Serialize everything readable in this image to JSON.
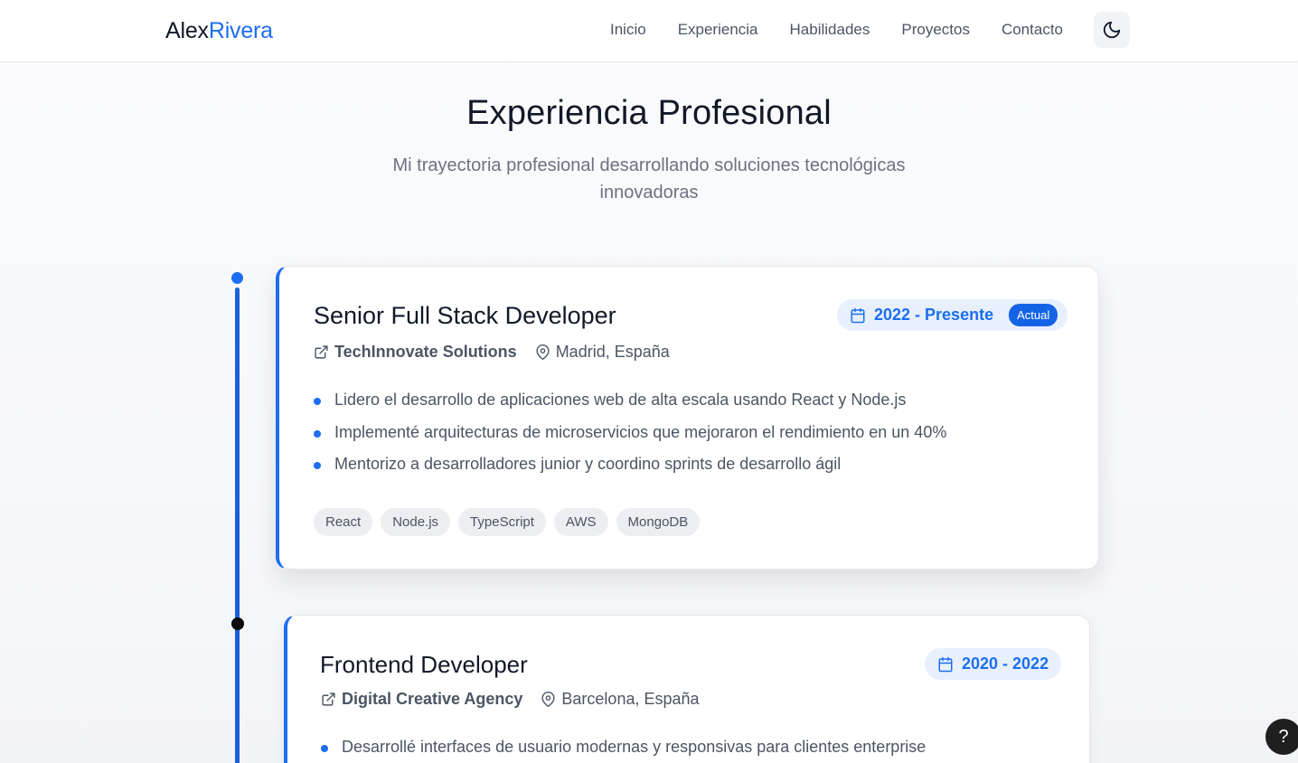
{
  "header": {
    "logo_first": "Alex",
    "logo_last": "Rivera",
    "nav": [
      "Inicio",
      "Experiencia",
      "Habilidades",
      "Proyectos",
      "Contacto"
    ],
    "theme_icon": "moon-icon"
  },
  "section": {
    "title": "Experiencia Profesional",
    "subtitle": "Mi trayectoria profesional desarrollando soluciones tecnológicas innovadoras"
  },
  "jobs": [
    {
      "title": "Senior Full Stack Developer",
      "company": "TechInnovate Solutions",
      "location": "Madrid, España",
      "period": "2022 - Presente",
      "badge": "Actual",
      "bullets": [
        "Lidero el desarrollo de aplicaciones web de alta escala usando React y Node.js",
        "Implementé arquitecturas de microservicios que mejoraron el rendimiento en un 40%",
        "Mentorizo a desarrolladores junior y coordino sprints de desarrollo ágil"
      ],
      "tags": [
        "React",
        "Node.js",
        "TypeScript",
        "AWS",
        "MongoDB"
      ]
    },
    {
      "title": "Frontend Developer",
      "company": "Digital Creative Agency",
      "location": "Barcelona, España",
      "period": "2020 - 2022",
      "bullets": [
        "Desarrollé interfaces de usuario modernas y responsivas para clientes enterprise"
      ]
    }
  ],
  "help_label": "?",
  "colors": {
    "accent": "#1d6ef0",
    "timeline": "#1d5fd6",
    "badge_bg": "#e8f0fd",
    "tag_bg": "#eceef1"
  }
}
